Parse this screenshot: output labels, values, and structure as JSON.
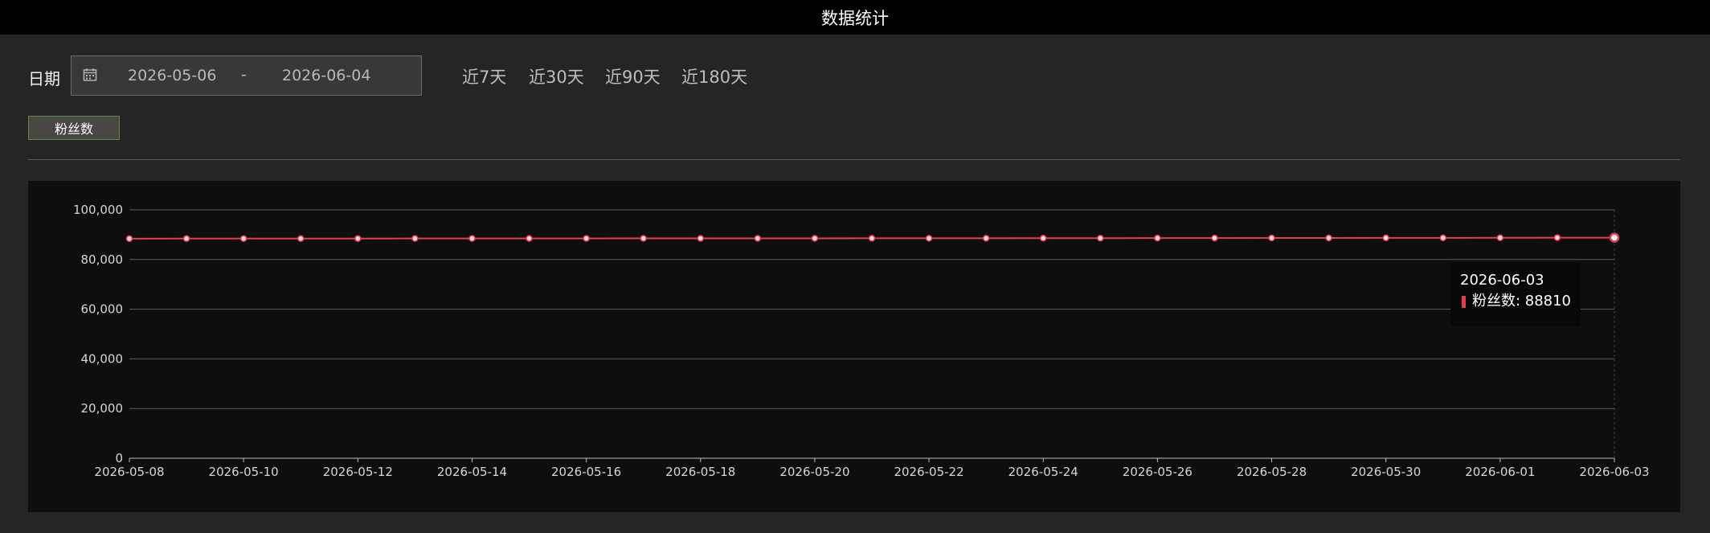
{
  "header": {
    "title": "数据统计"
  },
  "filter": {
    "date_label": "日期",
    "start_date": "2026-05-06",
    "separator": "-",
    "end_date": "2026-06-04",
    "quick_ranges": [
      "近7天",
      "近30天",
      "近90天",
      "近180天"
    ]
  },
  "metric_button": {
    "label": "粉丝数"
  },
  "tooltip": {
    "date": "2026-06-03",
    "series": "粉丝数",
    "value_text": " : 88810"
  },
  "icons": {
    "calendar": "calendar-icon"
  },
  "colors": {
    "series": "#e43d55",
    "accent_border": "#5c8a4a"
  },
  "chart_data": {
    "type": "line",
    "x": [
      "2026-05-08",
      "2026-05-09",
      "2026-05-10",
      "2026-05-11",
      "2026-05-12",
      "2026-05-13",
      "2026-05-14",
      "2026-05-15",
      "2026-05-16",
      "2026-05-17",
      "2026-05-18",
      "2026-05-19",
      "2026-05-20",
      "2026-05-21",
      "2026-05-22",
      "2026-05-23",
      "2026-05-24",
      "2026-05-25",
      "2026-05-26",
      "2026-05-27",
      "2026-05-28",
      "2026-05-29",
      "2026-05-30",
      "2026-05-31",
      "2026-06-01",
      "2026-06-02",
      "2026-06-03"
    ],
    "x_tick_labels": [
      "2026-05-08",
      "2026-05-10",
      "2026-05-12",
      "2026-05-14",
      "2026-05-16",
      "2026-05-18",
      "2026-05-20",
      "2026-05-22",
      "2026-05-24",
      "2026-05-26",
      "2026-05-28",
      "2026-05-30",
      "2026-06-01",
      "2026-06-03"
    ],
    "series": [
      {
        "name": "粉丝数",
        "values": [
          88400,
          88420,
          88430,
          88440,
          88450,
          88460,
          88470,
          88480,
          88490,
          88500,
          88510,
          88520,
          88530,
          88540,
          88550,
          88560,
          88580,
          88600,
          88620,
          88640,
          88660,
          88680,
          88700,
          88720,
          88750,
          88780,
          88810
        ]
      }
    ],
    "ylim": [
      0,
      100000
    ],
    "y_ticks": [
      0,
      20000,
      40000,
      60000,
      80000,
      100000
    ],
    "y_tick_labels": [
      "0",
      "20,000",
      "40,000",
      "60,000",
      "80,000",
      "100,000"
    ],
    "grid": true,
    "legend": "none"
  }
}
